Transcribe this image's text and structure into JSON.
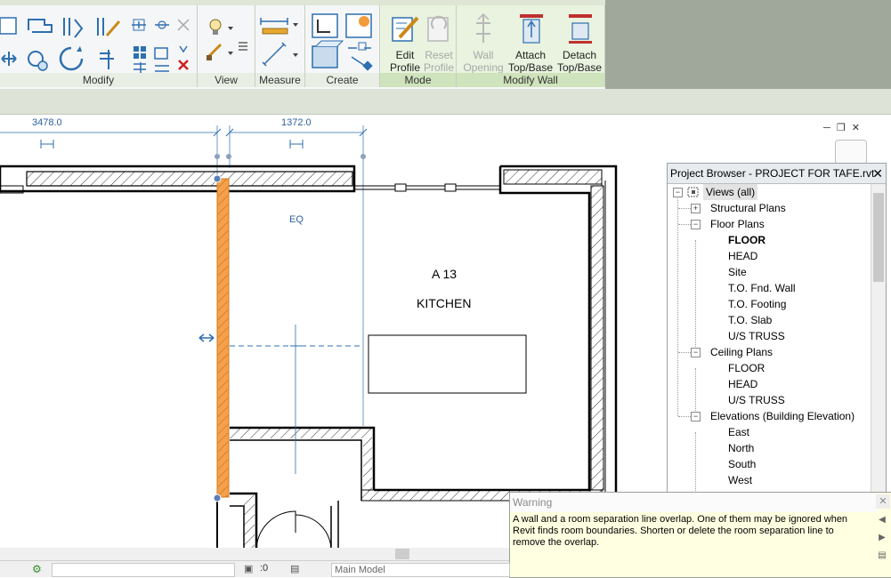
{
  "ribbon": {
    "panels": {
      "modify": "Modify",
      "view": "View",
      "measure": "Measure",
      "create": "Create",
      "mode": "Mode",
      "modify_wall": "Modify Wall"
    },
    "buttons": {
      "edit_profile": [
        "Edit",
        "Profile"
      ],
      "reset_profile": [
        "Reset",
        "Profile"
      ],
      "wall_opening": [
        "Wall",
        "Opening"
      ],
      "attach": [
        "Attach",
        "Top/Base"
      ],
      "detach": [
        "Detach",
        "Top/Base"
      ]
    },
    "colors": {
      "accent_green": "#cfe3bc",
      "delete_red": "#d02020"
    }
  },
  "canvas": {
    "dim_left": "3478.0",
    "dim_right": "1372.0",
    "eq": "EQ",
    "room_number": "A 13",
    "room_name": "KITCHEN",
    "selection_color": "#f5a04a"
  },
  "project_browser": {
    "title": "Project Browser - PROJECT FOR TAFE.rvt",
    "close": "✕",
    "root": "Views (all)",
    "groups": [
      {
        "label": "Structural Plans",
        "expanded": false,
        "items": []
      },
      {
        "label": "Floor Plans",
        "expanded": true,
        "items": [
          "FLOOR",
          "HEAD",
          "Site",
          "T.O. Fnd. Wall",
          "T.O. Footing",
          "T.O. Slab",
          "U/S TRUSS"
        ],
        "active_index": 0
      },
      {
        "label": "Ceiling Plans",
        "expanded": true,
        "items": [
          "FLOOR",
          "HEAD",
          "U/S TRUSS"
        ]
      },
      {
        "label": "Elevations (Building Elevation)",
        "expanded": true,
        "items": [
          "East",
          "North",
          "South",
          "West"
        ]
      }
    ]
  },
  "warning": {
    "title": "Warning",
    "message": "A wall and a room separation line overlap. One of them may be ignored when Revit finds room boundaries. Shorten or delete the room separation line to remove the overlap."
  },
  "status_bar": {
    "zero": ":0",
    "model": "Main Model"
  }
}
